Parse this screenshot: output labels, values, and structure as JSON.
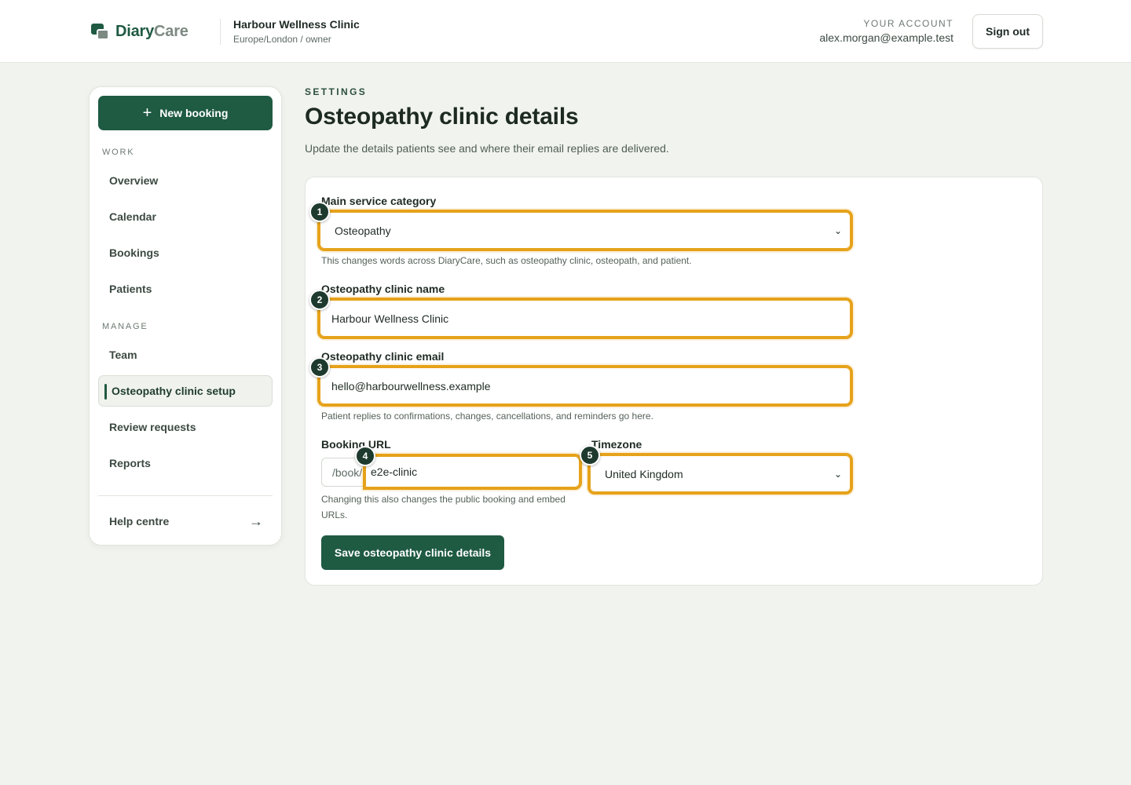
{
  "header": {
    "logo_diary": "Diary",
    "logo_care": "Care",
    "clinic_name": "Harbour Wellness Clinic",
    "clinic_sub": "Europe/London / owner",
    "account_label": "YOUR ACCOUNT",
    "account_email": "alex.morgan@example.test",
    "sign_out": "Sign out"
  },
  "sidebar": {
    "new_booking": "New booking",
    "section_work": "WORK",
    "work_items": [
      "Overview",
      "Calendar",
      "Bookings",
      "Patients"
    ],
    "section_manage": "MANAGE",
    "manage_items": [
      "Team",
      "Osteopathy clinic setup",
      "Review requests",
      "Reports"
    ],
    "active_item": "Osteopathy clinic setup",
    "help": "Help centre",
    "help_arrow": "→"
  },
  "main": {
    "eyebrow": "SETTINGS",
    "title": "Osteopathy clinic details",
    "subtitle": "Update the details patients see and where their email replies are delivered.",
    "form": {
      "category_label": "Main service category",
      "category_value": "Osteopathy",
      "category_hint": "This changes words across DiaryCare, such as osteopathy clinic, osteopath, and patient.",
      "name_label": "Osteopathy clinic name",
      "name_value": "Harbour Wellness Clinic",
      "email_label": "Osteopathy clinic email",
      "email_value": "hello@harbourwellness.example",
      "email_hint": "Patient replies to confirmations, changes, cancellations, and reminders go here.",
      "url_label": "Booking URL",
      "url_prefix": "/book/",
      "url_value": "e2e-clinic",
      "url_hint": "Changing this also changes the public booking and embed URLs.",
      "timezone_label": "Timezone",
      "timezone_value": "United Kingdom",
      "save": "Save osteopathy clinic details"
    },
    "badges": [
      "1",
      "2",
      "3",
      "4",
      "5"
    ]
  },
  "colors": {
    "brand": "#1f5a43",
    "highlight": "#e6a21a",
    "badge": "#1e3a2f"
  }
}
